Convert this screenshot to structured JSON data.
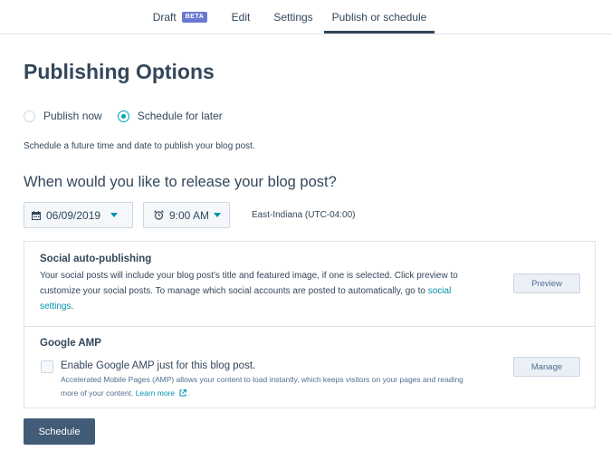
{
  "tabs": [
    {
      "label": "Draft",
      "badge": "BETA"
    },
    {
      "label": "Edit"
    },
    {
      "label": "Settings"
    },
    {
      "label": "Publish or schedule",
      "active": true
    }
  ],
  "page_title": "Publishing Options",
  "publish_mode": {
    "options": [
      "Publish now",
      "Schedule for later"
    ],
    "selected": "Schedule for later"
  },
  "description": "Schedule a future time and date to publish your blog post.",
  "release_question": "When would you like to release your blog post?",
  "date_select": {
    "value": "06/09/2019",
    "icon": "calendar-icon"
  },
  "time_select": {
    "value": "9:00 AM",
    "icon": "alarm-clock-icon"
  },
  "timezone": "East-Indiana (UTC-04:00)",
  "social": {
    "title": "Social auto-publishing",
    "text_line1": "Your social posts will include your blog post's title and featured image, if one is selected. Click preview to",
    "text_line2_prefix": "customize your social posts. To manage which social accounts are posted to automatically, go to ",
    "link_part1": "social",
    "link_part2": "settings",
    "text_suffix": ".",
    "button": "Preview"
  },
  "amp": {
    "title": "Google AMP",
    "checkbox_label": "Enable Google AMP just for this blog post.",
    "checked": false,
    "note_line1": "Accelerated Mobile Pages (AMP) allows your content to load instantly, which keeps visitors on your pages and reading",
    "note_line2_prefix": "more of your content. ",
    "learn_more": "Learn more",
    "note_suffix": ".",
    "button": "Manage"
  },
  "schedule_button": "Schedule",
  "colors": {
    "accent": "#00a4bd",
    "link": "#0091ae",
    "primary_button": "#425b76",
    "beta_badge": "#6a78d1",
    "text": "#33475b"
  }
}
